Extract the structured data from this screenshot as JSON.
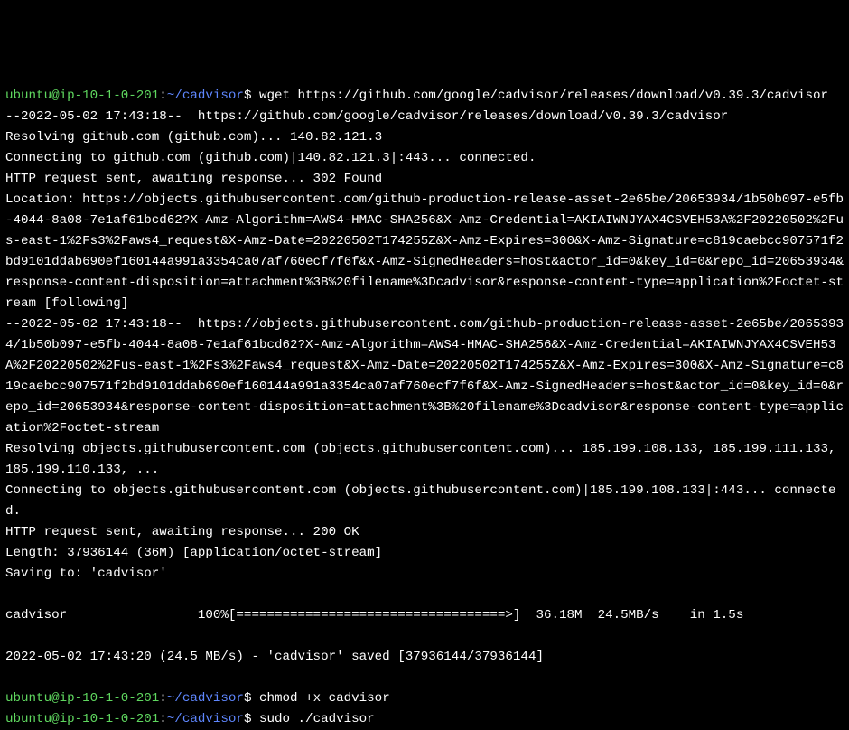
{
  "prompt": {
    "user_host": "ubuntu@ip-10-1-0-201",
    "colon": ":",
    "path": "~/cadvisor",
    "dollar": "$ "
  },
  "commands": {
    "wget": "wget https://github.com/google/cadvisor/releases/download/v0.39.3/cadvisor",
    "chmod": "chmod +x cadvisor",
    "sudo": "sudo ./cadvisor"
  },
  "output": {
    "line1": "--2022-05-02 17:43:18--  https://github.com/google/cadvisor/releases/download/v0.39.3/cadvisor",
    "line2": "Resolving github.com (github.com)... 140.82.121.3",
    "line3": "Connecting to github.com (github.com)|140.82.121.3|:443... connected.",
    "line4": "HTTP request sent, awaiting response... 302 Found",
    "line5": "Location: https://objects.githubusercontent.com/github-production-release-asset-2e65be/20653934/1b50b097-e5fb-4044-8a08-7e1af61bcd62?X-Amz-Algorithm=AWS4-HMAC-SHA256&X-Amz-Credential=AKIAIWNJYAX4CSVEH53A%2F20220502%2Fus-east-1%2Fs3%2Faws4_request&X-Amz-Date=20220502T174255Z&X-Amz-Expires=300&X-Amz-Signature=c819caebcc907571f2bd9101ddab690ef160144a991a3354ca07af760ecf7f6f&X-Amz-SignedHeaders=host&actor_id=0&key_id=0&repo_id=20653934&response-content-disposition=attachment%3B%20filename%3Dcadvisor&response-content-type=application%2Foctet-stream [following]",
    "line6": "--2022-05-02 17:43:18--  https://objects.githubusercontent.com/github-production-release-asset-2e65be/20653934/1b50b097-e5fb-4044-8a08-7e1af61bcd62?X-Amz-Algorithm=AWS4-HMAC-SHA256&X-Amz-Credential=AKIAIWNJYAX4CSVEH53A%2F20220502%2Fus-east-1%2Fs3%2Faws4_request&X-Amz-Date=20220502T174255Z&X-Amz-Expires=300&X-Amz-Signature=c819caebcc907571f2bd9101ddab690ef160144a991a3354ca07af760ecf7f6f&X-Amz-SignedHeaders=host&actor_id=0&key_id=0&repo_id=20653934&response-content-disposition=attachment%3B%20filename%3Dcadvisor&response-content-type=application%2Foctet-stream",
    "line7": "Resolving objects.githubusercontent.com (objects.githubusercontent.com)... 185.199.108.133, 185.199.111.133, 185.199.110.133, ...",
    "line8": "Connecting to objects.githubusercontent.com (objects.githubusercontent.com)|185.199.108.133|:443... connected.",
    "line9": "HTTP request sent, awaiting response... 200 OK",
    "line10": "Length: 37936144 (36M) [application/octet-stream]",
    "line11": "Saving to: 'cadvisor'",
    "line12": "",
    "line13": "cadvisor                 100%[===================================>]  36.18M  24.5MB/s    in 1.5s",
    "line14": "",
    "line15": "2022-05-02 17:43:20 (24.5 MB/s) - 'cadvisor' saved [37936144/37936144]",
    "line16": ""
  }
}
